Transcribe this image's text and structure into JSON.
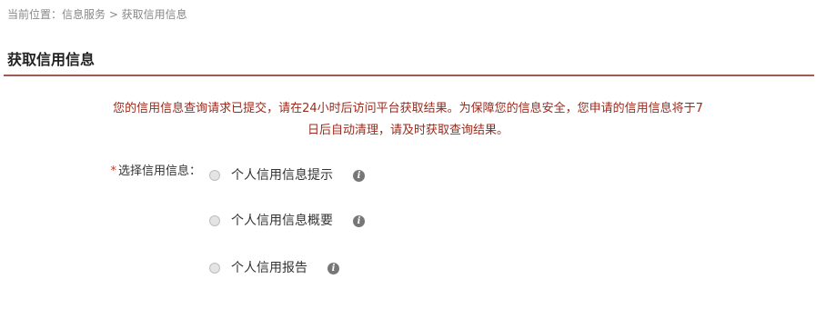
{
  "breadcrumb": {
    "text": "当前位置：信息服务 > 获取信用信息"
  },
  "page": {
    "title": "获取信用信息"
  },
  "notice": {
    "line1": "您的信用信息查询请求已提交，请在24小时后访问平台获取结果。为保障您的信息安全，您申请的信用信息将于7",
    "line2": "日后自动清理，请及时获取查询结果。"
  },
  "form": {
    "required_mark": "*",
    "field_label": "选择信用信息：",
    "options": [
      {
        "label": "个人信用信息提示",
        "info_icon": "info-icon"
      },
      {
        "label": "个人信用信息概要",
        "info_icon": "info-icon"
      },
      {
        "label": "个人信用报告",
        "info_icon": "info-icon"
      }
    ]
  },
  "colors": {
    "accent_rule": "#a05a4f",
    "notice_text": "#9b2a1c",
    "required_star": "#c0392b"
  }
}
